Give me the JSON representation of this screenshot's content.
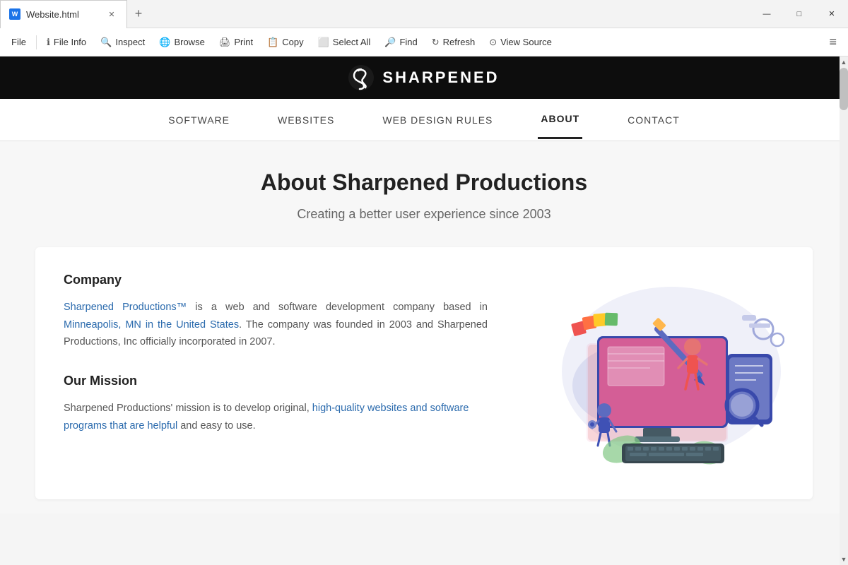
{
  "window": {
    "tab_title": "Website.html",
    "controls": {
      "minimize": "—",
      "maximize": "□",
      "close": "✕"
    }
  },
  "toolbar": {
    "file_label": "File",
    "file_info_label": "File Info",
    "inspect_label": "Inspect",
    "browse_label": "Browse",
    "print_label": "Print",
    "copy_label": "Copy",
    "select_all_label": "Select All",
    "find_label": "Find",
    "refresh_label": "Refresh",
    "view_source_label": "View Source"
  },
  "site": {
    "logo_text": "SHARPENED",
    "nav": {
      "items": [
        {
          "label": "SOFTWARE",
          "active": false
        },
        {
          "label": "WEBSITES",
          "active": false
        },
        {
          "label": "WEB DESIGN RULES",
          "active": false
        },
        {
          "label": "ABOUT",
          "active": true
        },
        {
          "label": "CONTACT",
          "active": false
        }
      ]
    },
    "page_title": "About Sharpened Productions",
    "page_subtitle": "Creating a better user experience since 2003",
    "company_heading": "Company",
    "company_body": "Sharpened Productions™ is a web and software development company based in Minneapolis, MN in the United States. The company was founded in 2003 and Sharpened Productions, Inc officially incorporated in 2007.",
    "mission_heading": "Our Mission",
    "mission_body": "Sharpened Productions' mission is to develop original, high-quality websites and software programs that are helpful and easy to use."
  }
}
